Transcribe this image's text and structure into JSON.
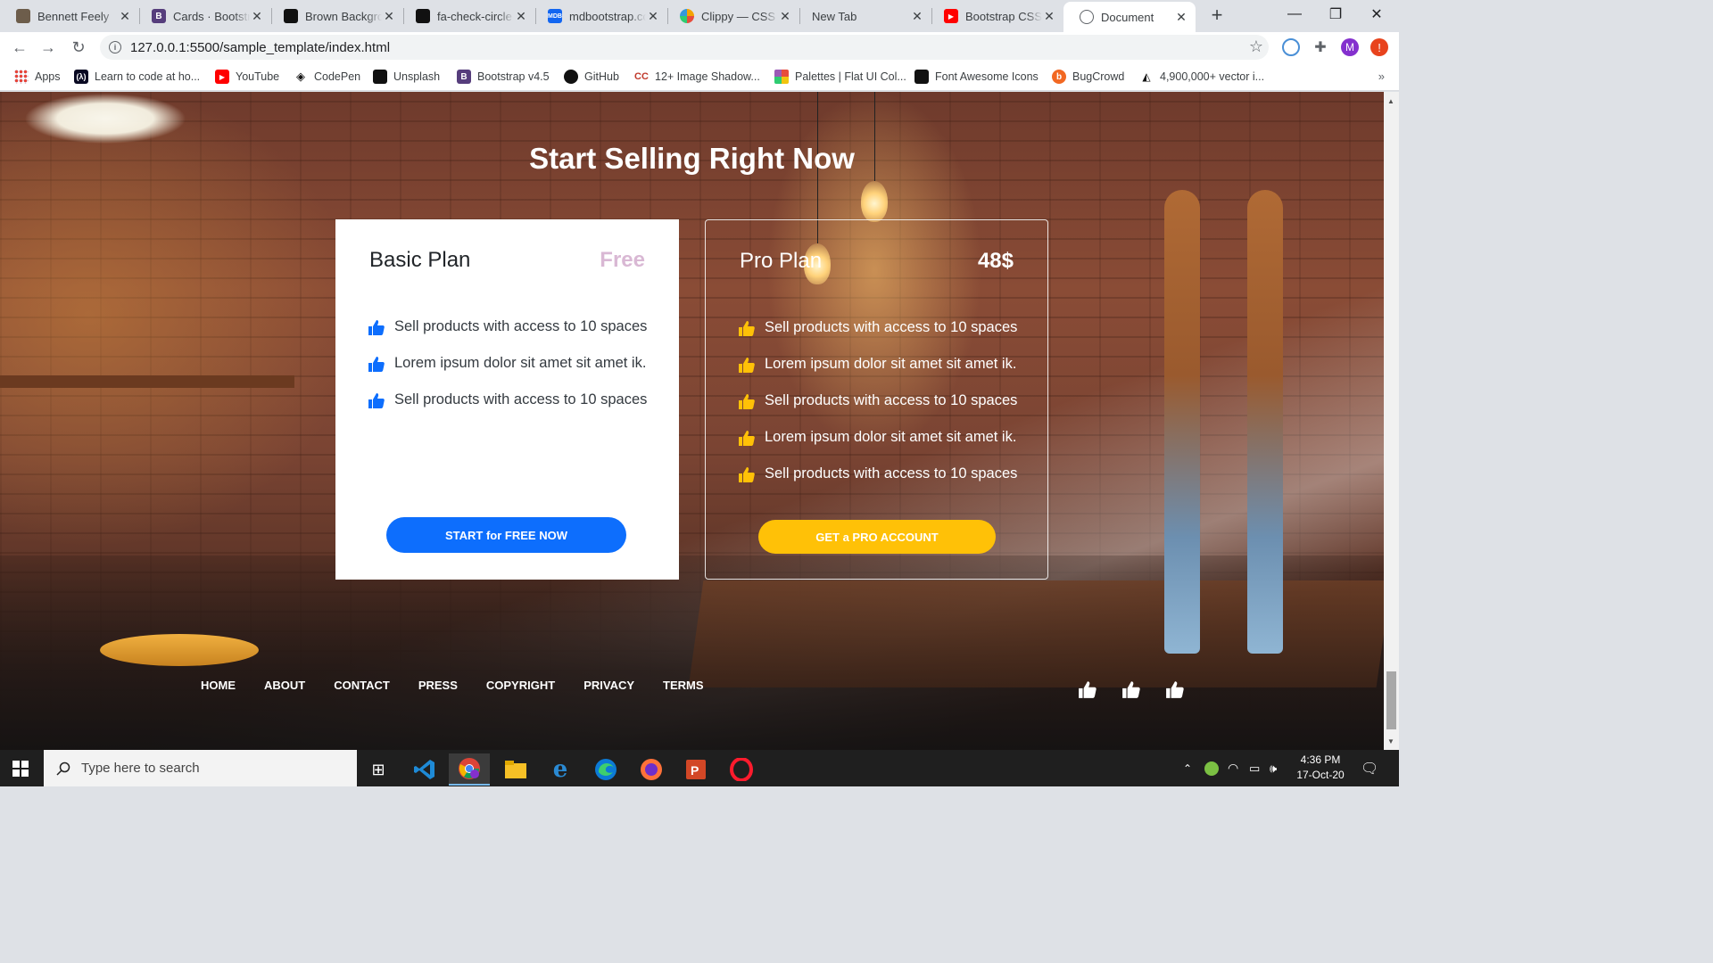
{
  "browser": {
    "tabs": [
      {
        "title": "Bennett Feely",
        "favicon": "image-icon",
        "color": "#6d5d4b"
      },
      {
        "title": "Cards · Bootstrap",
        "favicon": "bootstrap-icon",
        "color": "#563d7c"
      },
      {
        "title": "Brown Background",
        "favicon": "unsplash-icon",
        "color": "#111111"
      },
      {
        "title": "fa-check-circle",
        "favicon": "font-awesome-icon",
        "color": "#111111"
      },
      {
        "title": "mdbootstrap.com",
        "favicon": "mdb-icon",
        "color": "#1266f1"
      },
      {
        "title": "Clippy — CSS clip-path maker",
        "favicon": "clippy-icon",
        "color": "#f4a300"
      },
      {
        "title": "New Tab",
        "favicon": "",
        "color": ""
      },
      {
        "title": "Bootstrap CSS",
        "favicon": "youtube-icon",
        "color": "#ff0000"
      },
      {
        "title": "Document",
        "favicon": "globe-icon",
        "color": "#5f6368"
      }
    ],
    "url": "127.0.0.1:5500/sample_template/index.html",
    "profile_initial": "M",
    "bookmarks": [
      {
        "label": "Apps",
        "icon": "apps-grid-icon"
      },
      {
        "label": "Learn to code at ho...",
        "icon": "freecodecamp-icon"
      },
      {
        "label": "YouTube",
        "icon": "youtube-icon"
      },
      {
        "label": "CodePen",
        "icon": "codepen-icon"
      },
      {
        "label": "Unsplash",
        "icon": "unsplash-icon"
      },
      {
        "label": "Bootstrap v4.5",
        "icon": "bootstrap-icon"
      },
      {
        "label": "GitHub",
        "icon": "github-icon"
      },
      {
        "label": "12+ Image Shadow...",
        "icon": "link-icon"
      },
      {
        "label": "Palettes | Flat UI Col...",
        "icon": "palette-icon"
      },
      {
        "label": "Font Awesome Icons",
        "icon": "font-awesome-icon"
      },
      {
        "label": "BugCrowd",
        "icon": "bugcrowd-icon"
      },
      {
        "label": "4,900,000+  vector i...",
        "icon": "vector-icon"
      }
    ]
  },
  "page": {
    "heading": "Start Selling Right Now",
    "basic": {
      "name": "Basic Plan",
      "price": "Free",
      "features": [
        "Sell products with access to 10 spaces",
        "Lorem ipsum dolor sit amet sit amet ik.",
        "Sell products with access to 10 spaces"
      ],
      "cta": "START for FREE NOW",
      "thumb_color": "#0d6efd"
    },
    "pro": {
      "name": "Pro Plan",
      "price": "48$",
      "features": [
        "Sell products with access to 10 spaces",
        "Lorem ipsum dolor sit amet sit amet ik.",
        "Sell products with access to 10 spaces",
        "Lorem ipsum dolor sit amet sit amet ik.",
        "Sell products with access to 10 spaces"
      ],
      "cta": "GET a PRO ACCOUNT",
      "thumb_color": "#ffc107"
    },
    "footer_links": [
      "HOME",
      "ABOUT",
      "CONTACT",
      "PRESS",
      "COPYRIGHT",
      "PRIVACY",
      "TERMS"
    ]
  },
  "taskbar": {
    "search_placeholder": "Type here to search",
    "time": "4:36 PM",
    "date": "17-Oct-20"
  }
}
